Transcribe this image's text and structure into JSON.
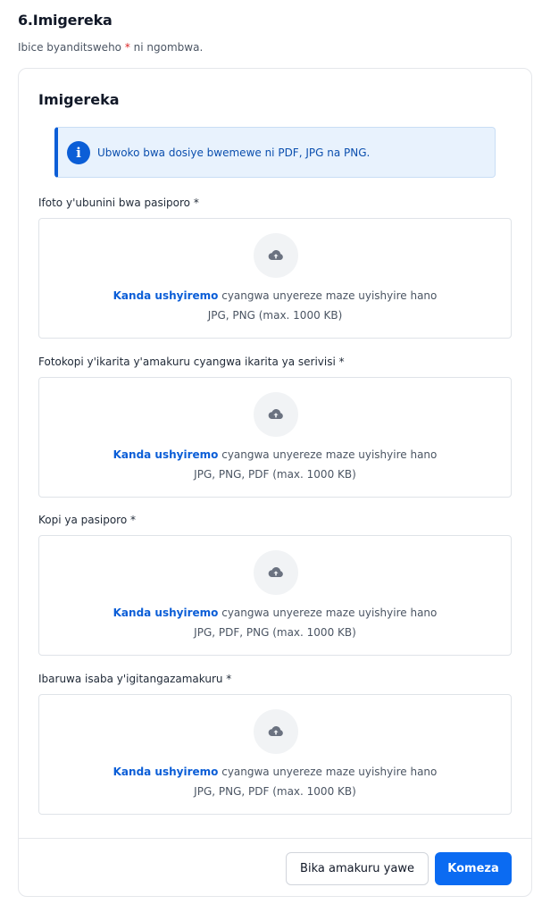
{
  "section": {
    "title": "6.Imigereka",
    "required_note_prefix": "Ibice byanditsweho ",
    "required_star": "*",
    "required_note_suffix": " ni ngombwa."
  },
  "card": {
    "title": "Imigereka",
    "info": {
      "icon": "info-icon",
      "text": "Ubwoko bwa dosiye bwemewe ni PDF, JPG na PNG."
    }
  },
  "uploads": [
    {
      "label": "Ifoto y'ubunini bwa pasiporo *",
      "link_text": "Kanda ushyiremo",
      "instruction": " cyangwa unyereze maze uyishyire hano",
      "formats": "JPG, PNG (max. 1000 KB)"
    },
    {
      "label": "Fotokopi y'ikarita y'amakuru cyangwa ikarita ya serivisi *",
      "link_text": "Kanda ushyiremo",
      "instruction": " cyangwa unyereze maze uyishyire hano",
      "formats": "JPG, PNG, PDF (max. 1000 KB)"
    },
    {
      "label": "Kopi ya pasiporo *",
      "link_text": "Kanda ushyiremo",
      "instruction": " cyangwa unyereze maze uyishyire hano",
      "formats": "JPG, PDF, PNG (max. 1000 KB)"
    },
    {
      "label": "Ibaruwa isaba y'igitangazamakuru *",
      "link_text": "Kanda ushyiremo",
      "instruction": " cyangwa unyereze maze uyishyire hano",
      "formats": "JPG, PNG, PDF (max. 1000 KB)"
    }
  ],
  "actions": {
    "save_label": "Bika amakuru yawe",
    "continue_label": "Komeza"
  },
  "colors": {
    "accent": "#0b6bf2",
    "link": "#0b5ed7",
    "required": "#dc2626",
    "info_bg": "#e8f2fd"
  }
}
